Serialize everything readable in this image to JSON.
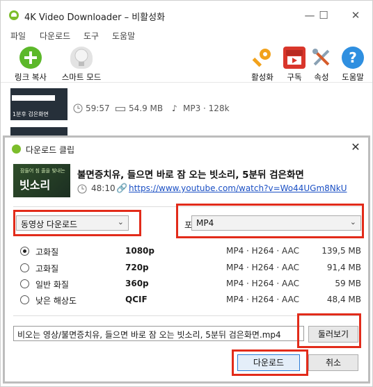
{
  "window": {
    "title": "4K Video Downloader – 비활성화",
    "controls": {
      "minimize": "—",
      "maximize": "☐",
      "close": "✕"
    }
  },
  "menu": [
    "파일",
    "다운로드",
    "도구",
    "도움말"
  ],
  "toolbar": {
    "left": [
      {
        "label": "링크 복사",
        "icon": "plus-icon",
        "color": "#5cb82a"
      },
      {
        "label": "스마트 모드",
        "icon": "lightbulb-icon",
        "color": "#d9d9d9"
      }
    ],
    "right": [
      {
        "label": "활성화",
        "icon": "key-icon",
        "color": "#f2a21c"
      },
      {
        "label": "구독",
        "icon": "subscribe-icon",
        "color": "#d9362b"
      },
      {
        "label": "속성",
        "icon": "tools-icon",
        "color": "#8aa1b4"
      },
      {
        "label": "도움말",
        "icon": "help-icon",
        "color": "#2f8fe0"
      }
    ]
  },
  "list": [
    {
      "thumb_caption": "1분후 검은화면",
      "duration": "59:57",
      "size": "54.9 MB",
      "format": "MP3 · 128k"
    }
  ],
  "dialog": {
    "title": "다운로드 클립",
    "close": "✕",
    "video": {
      "thumb_line1": "잠들어 침 줄을 빛내는",
      "thumb_line2": "빗소리",
      "title": "불면증치유, 들으면 바로 잠 오는 빗소리, 5분뒤 검은화면",
      "duration": "48:10",
      "url": "https://www.youtube.com/watch?v=Wo44UGm8NkU"
    },
    "mode": "동영상 다운로드",
    "format_label": "포맷 :",
    "format": "MP4",
    "qualities": [
      {
        "name": "고화질",
        "res": "1080p",
        "codec": "MP4 · H264 · AAC",
        "size": "139,5 MB",
        "selected": true
      },
      {
        "name": "고화질",
        "res": "720p",
        "codec": "MP4 · H264 · AAC",
        "size": "91,4 MB",
        "selected": false
      },
      {
        "name": "일반 화질",
        "res": "360p",
        "codec": "MP4 · H264 · AAC",
        "size": "59 MB",
        "selected": false
      },
      {
        "name": "낮은 해상도",
        "res": "QCIF",
        "codec": "MP4 · H264 · AAC",
        "size": "48,4 MB",
        "selected": false
      }
    ],
    "save_path": "비오는 영상/불면증치유, 들으면 바로 잠 오는 빗소리, 5분뒤 검은화면.mp4",
    "browse_label": "둘러보기",
    "download_label": "다운로드",
    "cancel_label": "취소",
    "highlight_color": "#e22b1a"
  }
}
